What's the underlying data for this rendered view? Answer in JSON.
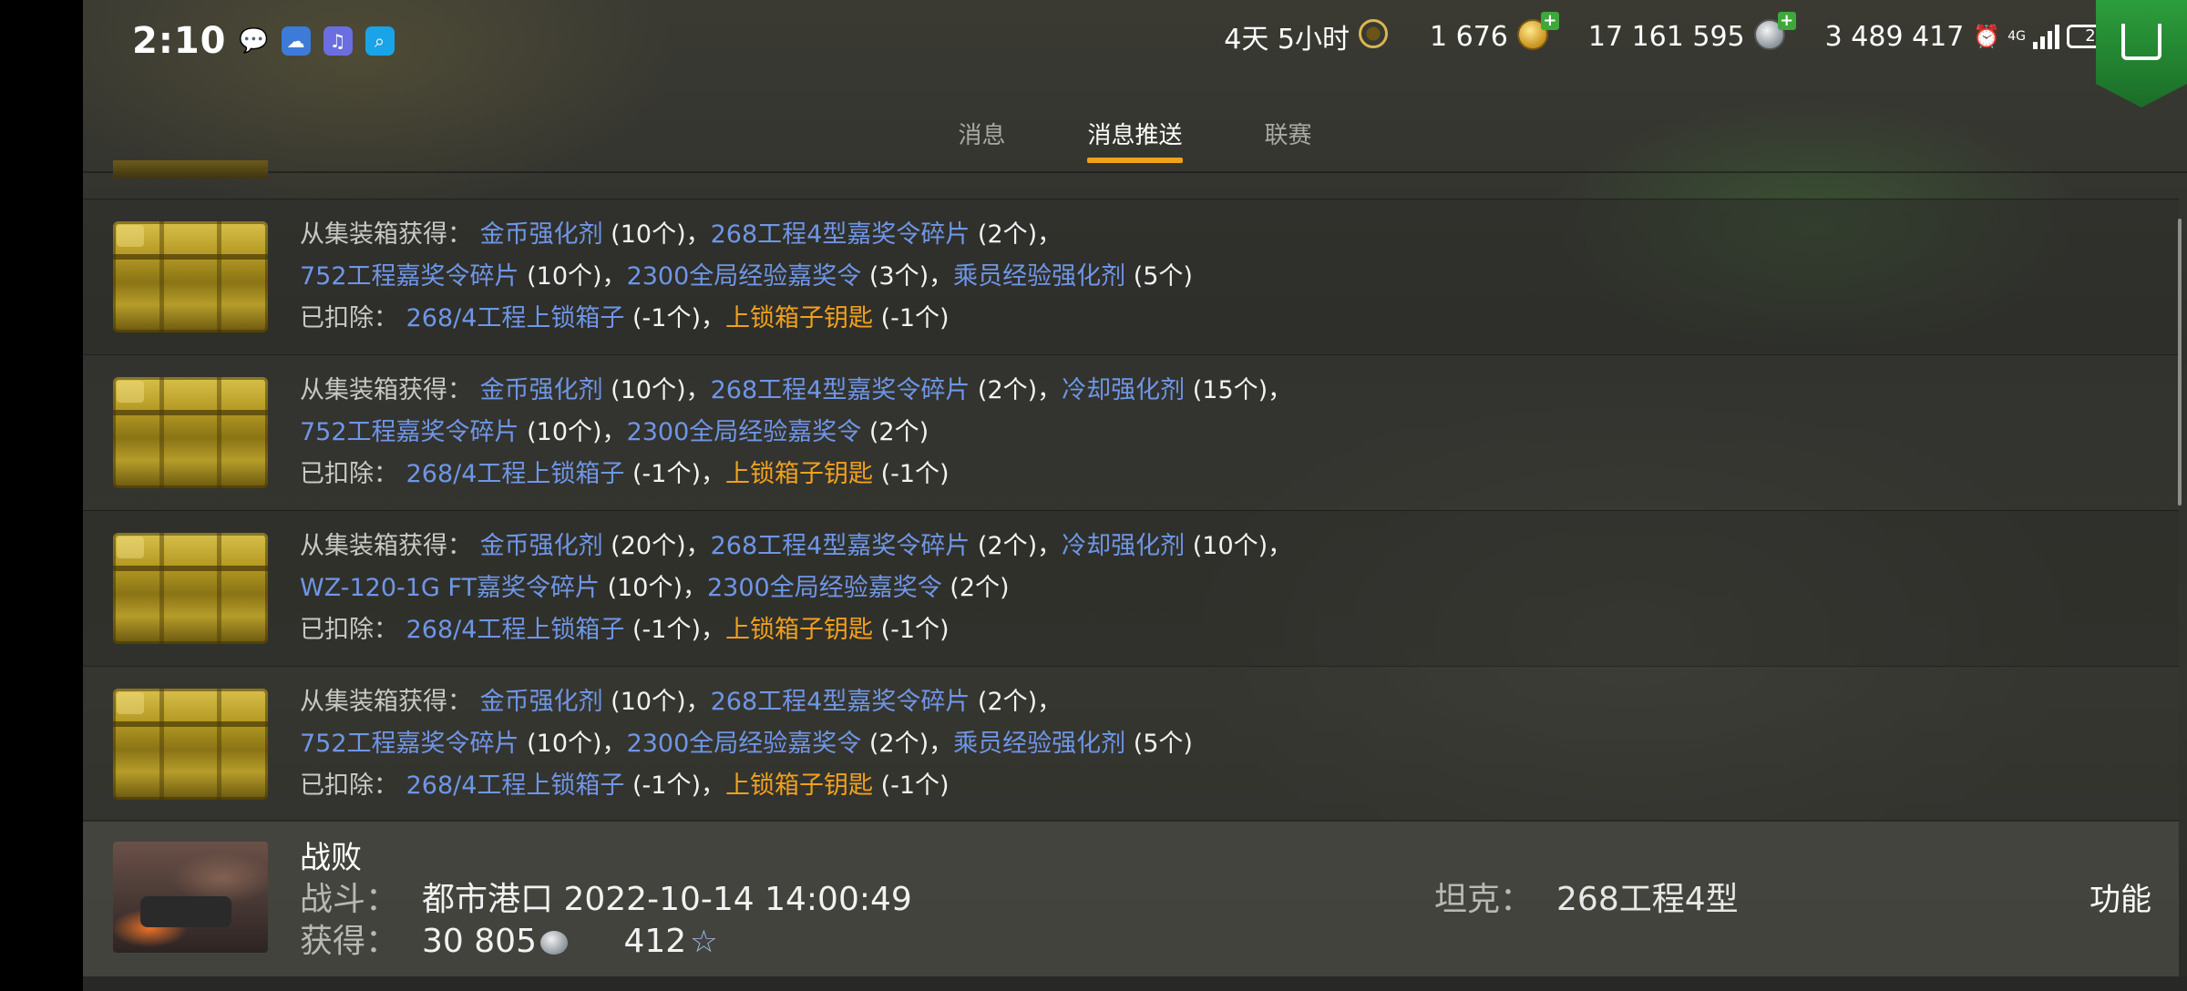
{
  "status_bar": {
    "time": "2:10",
    "icons": [
      "wechat-icon",
      "cloud-icon",
      "music-icon",
      "search-icon"
    ],
    "battery_level": "2"
  },
  "resources": [
    {
      "id": "premium",
      "value": "4天 5小时",
      "icon": "laurel-icon"
    },
    {
      "id": "gold",
      "value": "1 676",
      "icon": "gold-coin-icon",
      "has_plus": true
    },
    {
      "id": "credits",
      "value": "17 161 595",
      "icon": "silver-coin-icon",
      "has_plus": true
    },
    {
      "id": "free_xp",
      "value": "3 489 417",
      "icon": "xp-icon",
      "has_plus": true
    }
  ],
  "tabs": [
    {
      "label": "消息",
      "active": false
    },
    {
      "label": "消息推送",
      "active": true
    },
    {
      "label": "联赛",
      "active": false
    }
  ],
  "messages": [
    {
      "lines": [
        [
          [
            "lbl",
            "从集装箱获得： "
          ],
          [
            "blue",
            "金币强化剂"
          ],
          [
            "white",
            " (10个)，"
          ],
          [
            "blue",
            "268工程4型嘉奖令碎片"
          ],
          [
            "white",
            " (2个)，"
          ]
        ],
        [
          [
            "blue",
            "752工程嘉奖令碎片"
          ],
          [
            "white",
            " (10个)，"
          ],
          [
            "blue",
            "2300全局经验嘉奖令"
          ],
          [
            "white",
            " (3个)，"
          ],
          [
            "blue",
            "乘员经验强化剂"
          ],
          [
            "white",
            " (5个)"
          ]
        ],
        [
          [
            "lbl",
            "已扣除： "
          ],
          [
            "blue",
            "268/4工程上锁箱子"
          ],
          [
            "white",
            " (-1个)，"
          ],
          [
            "orange",
            "上锁箱子钥匙"
          ],
          [
            "white",
            " (-1个)"
          ]
        ]
      ]
    },
    {
      "lines": [
        [
          [
            "lbl",
            "从集装箱获得： "
          ],
          [
            "blue",
            "金币强化剂"
          ],
          [
            "white",
            " (10个)，"
          ],
          [
            "blue",
            "268工程4型嘉奖令碎片"
          ],
          [
            "white",
            " (2个)，"
          ],
          [
            "blue",
            "冷却强化剂"
          ],
          [
            "white",
            " (15个)，"
          ]
        ],
        [
          [
            "blue",
            "752工程嘉奖令碎片"
          ],
          [
            "white",
            " (10个)，"
          ],
          [
            "blue",
            "2300全局经验嘉奖令"
          ],
          [
            "white",
            " (2个)"
          ]
        ],
        [
          [
            "lbl",
            "已扣除： "
          ],
          [
            "blue",
            "268/4工程上锁箱子"
          ],
          [
            "white",
            " (-1个)，"
          ],
          [
            "orange",
            "上锁箱子钥匙"
          ],
          [
            "white",
            " (-1个)"
          ]
        ]
      ]
    },
    {
      "lines": [
        [
          [
            "lbl",
            "从集装箱获得： "
          ],
          [
            "blue",
            "金币强化剂"
          ],
          [
            "white",
            " (20个)，"
          ],
          [
            "blue",
            "268工程4型嘉奖令碎片"
          ],
          [
            "white",
            " (2个)，"
          ],
          [
            "blue",
            "冷却强化剂"
          ],
          [
            "white",
            " (10个)，"
          ]
        ],
        [
          [
            "blue",
            "WZ-120-1G FT嘉奖令碎片"
          ],
          [
            "white",
            " (10个)，"
          ],
          [
            "blue",
            "2300全局经验嘉奖令"
          ],
          [
            "white",
            " (2个)"
          ]
        ],
        [
          [
            "lbl",
            "已扣除： "
          ],
          [
            "blue",
            "268/4工程上锁箱子"
          ],
          [
            "white",
            " (-1个)，"
          ],
          [
            "orange",
            "上锁箱子钥匙"
          ],
          [
            "white",
            " (-1个)"
          ]
        ]
      ]
    },
    {
      "lines": [
        [
          [
            "lbl",
            "从集装箱获得： "
          ],
          [
            "blue",
            "金币强化剂"
          ],
          [
            "white",
            " (10个)，"
          ],
          [
            "blue",
            "268工程4型嘉奖令碎片"
          ],
          [
            "white",
            " (2个)，"
          ]
        ],
        [
          [
            "blue",
            "752工程嘉奖令碎片"
          ],
          [
            "white",
            " (10个)，"
          ],
          [
            "blue",
            "2300全局经验嘉奖令"
          ],
          [
            "white",
            " (2个)，"
          ],
          [
            "blue",
            "乘员经验强化剂"
          ],
          [
            "white",
            " (5个)"
          ]
        ],
        [
          [
            "lbl",
            "已扣除： "
          ],
          [
            "blue",
            "268/4工程上锁箱子"
          ],
          [
            "white",
            " (-1个)，"
          ],
          [
            "orange",
            "上锁箱子钥匙"
          ],
          [
            "white",
            " (-1个)"
          ]
        ]
      ]
    }
  ],
  "battle": {
    "title": "战败",
    "battle_label": "战斗：",
    "battle_value": "都市港口 2022-10-14 14:00:49",
    "earned_label": "获得：",
    "credits": "30 805",
    "xp": "412",
    "tank_label": "坦克：",
    "tank_value": "268工程4型",
    "function_label": "功能"
  },
  "colors": {
    "link_blue": "#6f96e6",
    "key_orange": "#f0a11e",
    "tab_underline": "#f0a21c",
    "shop_green": "#2c9e3c"
  }
}
